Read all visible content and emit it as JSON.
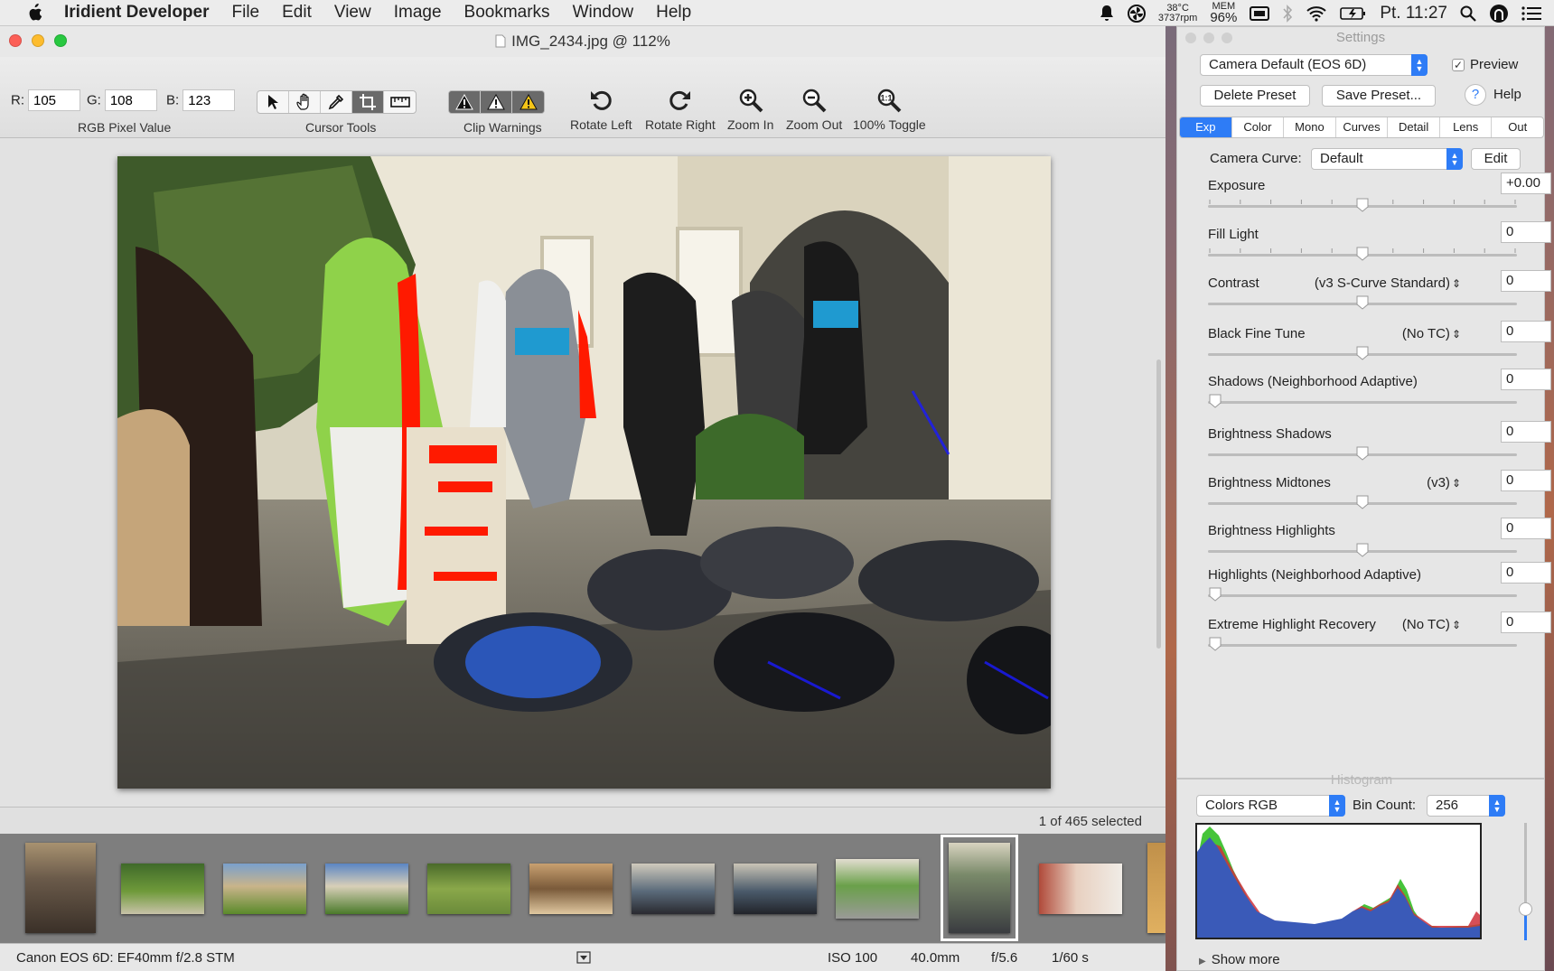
{
  "menubar": {
    "app_name": "Iridient Developer",
    "items": [
      "File",
      "Edit",
      "View",
      "Image",
      "Bookmarks",
      "Window",
      "Help"
    ],
    "temp": "38°C",
    "rpm": "3737rpm",
    "mem_label": "MEM",
    "mem_value": "96%",
    "clock": "Pt. 11:27"
  },
  "window": {
    "title": "IMG_2434.jpg @ 112%"
  },
  "toolbar": {
    "r_label": "R:",
    "r_value": "105",
    "g_label": "G:",
    "g_value": "108",
    "b_label": "B:",
    "b_value": "123",
    "rgb_caption": "RGB Pixel Value",
    "cursor_caption": "Cursor Tools",
    "clip_caption": "Clip Warnings",
    "rotate_left": "Rotate Left",
    "rotate_right": "Rotate Right",
    "zoom_in": "Zoom In",
    "zoom_out": "Zoom Out",
    "toggle_100": "100% Toggle"
  },
  "strip": {
    "selection": "1 of 465 selected"
  },
  "status": {
    "camera": "Canon EOS 6D: EF40mm f/2.8 STM",
    "iso": "ISO 100",
    "focal": "40.0mm",
    "aperture": "f/5.6",
    "shutter": "1/60 s"
  },
  "settings": {
    "title": "Settings",
    "preset": "Camera Default (EOS 6D)",
    "preview_label": "Preview",
    "preview_checked": true,
    "delete_preset": "Delete Preset",
    "save_preset": "Save Preset...",
    "help": "Help",
    "tabs": [
      "Exp",
      "Color",
      "Mono",
      "Curves",
      "Detail",
      "Lens",
      "Out"
    ],
    "active_tab": "Exp",
    "camera_curve_label": "Camera Curve:",
    "camera_curve_value": "Default",
    "edit": "Edit",
    "controls": [
      {
        "label": "Exposure",
        "mode": "",
        "value": "+0.00",
        "level": 0.5
      },
      {
        "label": "Fill Light",
        "mode": "",
        "value": "0",
        "level": 0.5
      },
      {
        "label": "Contrast",
        "mode": "(v3 S-Curve Standard)",
        "value": "0",
        "level": 0.5
      },
      {
        "label": "Black Fine Tune",
        "mode": "(No TC)",
        "value": "0",
        "level": 0.5
      },
      {
        "label": "Shadows (Neighborhood Adaptive)",
        "mode": "",
        "value": "0",
        "level": 0.0
      },
      {
        "label": "Brightness Shadows",
        "mode": "",
        "value": "0",
        "level": 0.5
      },
      {
        "label": "Brightness Midtones",
        "mode": "(v3)",
        "value": "0",
        "level": 0.5
      },
      {
        "label": "Brightness Highlights",
        "mode": "",
        "value": "0",
        "level": 0.5
      },
      {
        "label": "Highlights (Neighborhood Adaptive)",
        "mode": "",
        "value": "0",
        "level": 0.0
      },
      {
        "label": "Extreme Highlight Recovery",
        "mode": "(No TC)",
        "value": "0",
        "level": 0.0
      }
    ]
  },
  "histogram": {
    "title": "Histogram",
    "mode": "Colors RGB",
    "bin_label": "Bin Count:",
    "bin_value": "256",
    "show_more": "Show more"
  },
  "colors": {
    "accent": "#2e7cf6",
    "clip_highlight": "#ff1a00",
    "clip_shadow": "#1a1aff"
  }
}
